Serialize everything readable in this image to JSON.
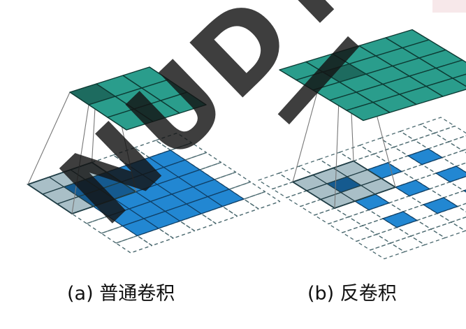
{
  "captions": {
    "a": "(a) 普通卷积",
    "b": "(b) 反卷积"
  },
  "watermark": {
    "text": "NUDT"
  },
  "diagram": {
    "conv": {
      "input_grid": 7,
      "input_cells": 5,
      "input_offset": 1,
      "output_grid": 3,
      "kernel_size": 3,
      "highlight_output_cell": [
        0,
        0
      ]
    },
    "deconv": {
      "input_cells": [
        [
          0,
          0
        ],
        [
          0,
          2
        ],
        [
          0,
          4
        ],
        [
          2,
          0
        ],
        [
          2,
          2
        ],
        [
          2,
          4
        ],
        [
          4,
          0
        ],
        [
          4,
          2
        ],
        [
          4,
          4
        ]
      ],
      "output_grid": 5,
      "kernel_size": 3,
      "highlight_output_cell": [
        1,
        1
      ]
    }
  },
  "colors": {
    "teal": "#2a9d8c",
    "teal_dark": "#1d6b5f",
    "blue": "#2287d2",
    "blue_dark": "#155a8f",
    "gray": "#a9bfc7",
    "dash": "#4c6a70",
    "line": "#777777"
  }
}
